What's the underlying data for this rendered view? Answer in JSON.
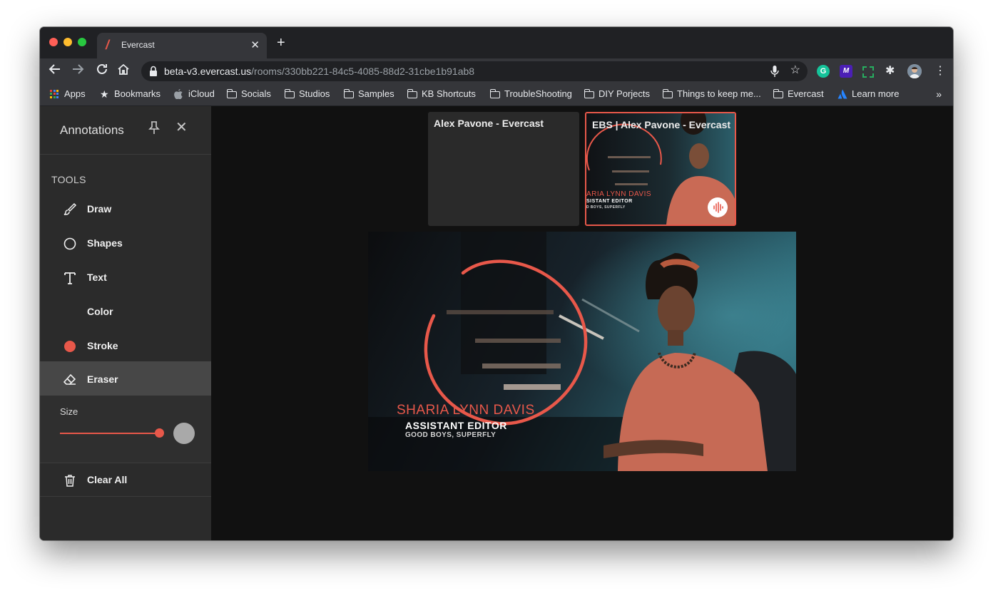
{
  "browser": {
    "tab_title": "Evercast",
    "url_host": "beta-v3.evercast.us",
    "url_path": "/rooms/330bb221-84c5-4085-88d2-31cbe1b91ab8",
    "bookmarks": [
      {
        "label": "Apps",
        "icon": "apps-grid-icon"
      },
      {
        "label": "Bookmarks",
        "icon": "star-icon"
      },
      {
        "label": "iCloud",
        "icon": "apple-icon"
      },
      {
        "label": "Socials",
        "icon": "folder-icon"
      },
      {
        "label": "Studios",
        "icon": "folder-icon"
      },
      {
        "label": "Samples",
        "icon": "folder-icon"
      },
      {
        "label": "KB Shortcuts",
        "icon": "folder-icon"
      },
      {
        "label": "TroubleShooting",
        "icon": "folder-icon"
      },
      {
        "label": "DIY Porjects",
        "icon": "folder-icon"
      },
      {
        "label": "Things to keep me...",
        "icon": "folder-icon"
      },
      {
        "label": "Evercast",
        "icon": "folder-icon"
      },
      {
        "label": "Learn more",
        "icon": "atlassian-icon"
      }
    ],
    "more_bookmarks": "»"
  },
  "sidebar": {
    "title": "Annotations",
    "section_label": "TOOLS",
    "tools": [
      {
        "label": "Draw",
        "icon": "brush-icon",
        "active": false
      },
      {
        "label": "Shapes",
        "icon": "circle-outline-icon",
        "active": false
      },
      {
        "label": "Text",
        "icon": "text-icon",
        "active": false
      },
      {
        "label": "Color",
        "icon": "none",
        "active": false
      },
      {
        "label": "Stroke",
        "icon": "red-dot-icon",
        "active": false
      },
      {
        "label": "Eraser",
        "icon": "eraser-icon",
        "active": true
      }
    ],
    "size_label": "Size",
    "size_value": 1.0,
    "clear_all_label": "Clear All"
  },
  "stage": {
    "tiles": [
      {
        "title": "Alex Pavone - Evercast",
        "active": false
      },
      {
        "title": "EBS | Alex Pavone - Evercast",
        "active": true
      }
    ],
    "lower_third": {
      "name": "SHARIA LYNN DAVIS",
      "role": "ASSISTANT EDITOR",
      "show": "GOOD BOYS, SUPERFLY"
    },
    "thumbnail_lower_third": {
      "name": "ARIA LYNN DAVIS",
      "role": "SISTANT EDITOR",
      "show": "D BOYS, SUPERFLY"
    }
  },
  "colors": {
    "accent": "#e8584a",
    "sidebar_bg": "#2b2b2b",
    "stage_bg": "#111111"
  }
}
